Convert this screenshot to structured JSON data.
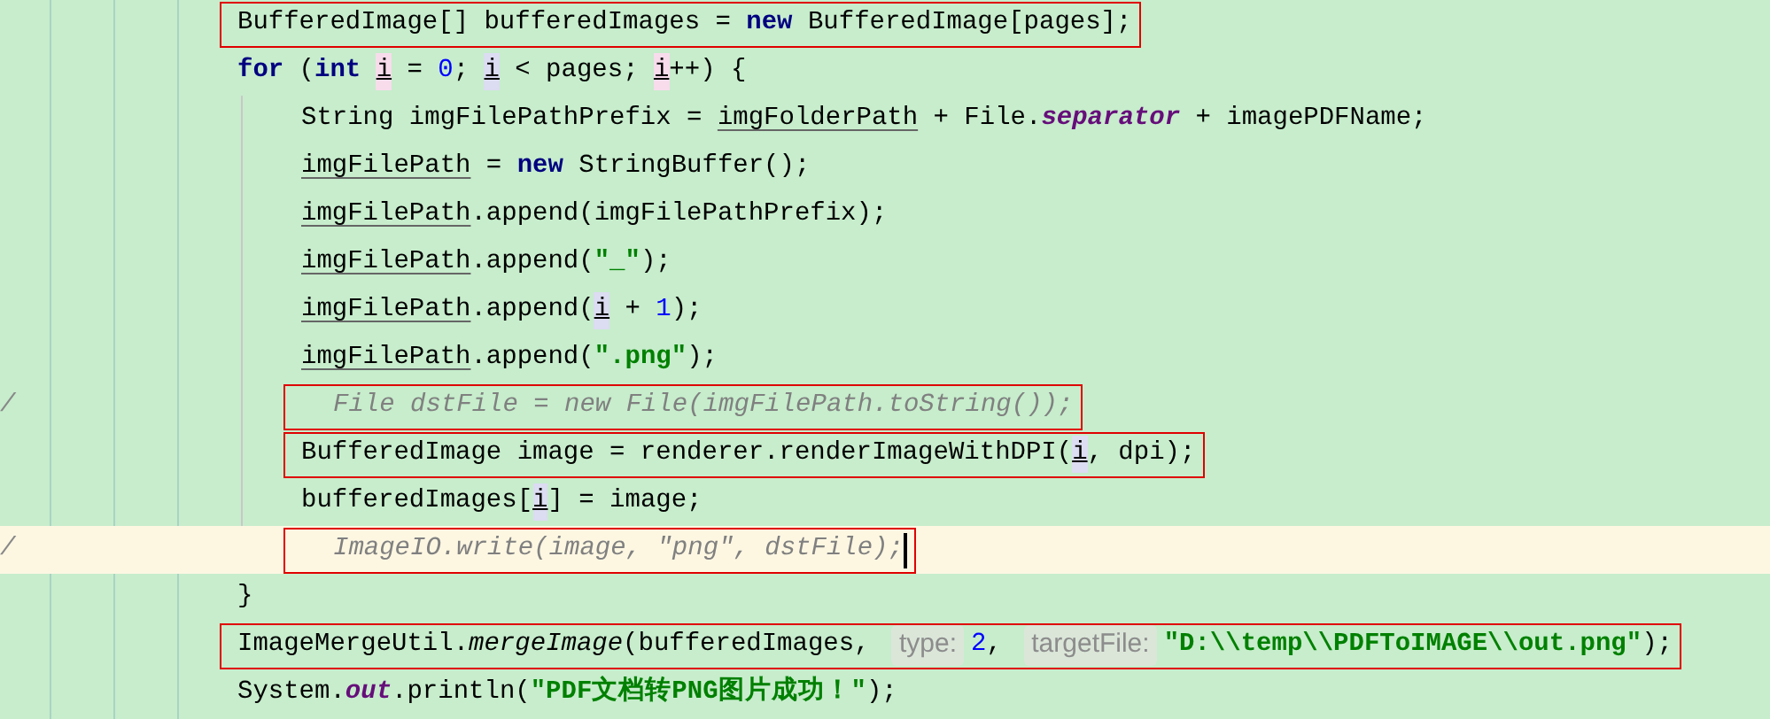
{
  "lines": [
    {
      "tokens": [
        {
          "kind": "plain",
          "text": "BufferedImage[] bufferedImages = "
        },
        {
          "kind": "kw",
          "text": "new"
        },
        {
          "kind": "plain",
          "text": " BufferedImage[pages];"
        }
      ],
      "boxed": true,
      "current": false
    },
    {
      "tokens": [
        {
          "kind": "kw",
          "text": "for"
        },
        {
          "kind": "plain",
          "text": " ("
        },
        {
          "kind": "kw",
          "text": "int "
        },
        {
          "kind": "iw",
          "text": "i"
        },
        {
          "kind": "plain",
          "text": " = "
        },
        {
          "kind": "num",
          "text": "0"
        },
        {
          "kind": "plain",
          "text": "; "
        },
        {
          "kind": "ir",
          "text": "i"
        },
        {
          "kind": "plain",
          "text": " < pages; "
        },
        {
          "kind": "iw",
          "text": "i"
        },
        {
          "kind": "plain",
          "text": "++) {"
        }
      ],
      "boxed": false,
      "current": false,
      "children": [
        {
          "tokens": [
            {
              "kind": "plain",
              "text": "String imgFilePathPrefix = "
            },
            {
              "kind": "ul",
              "text": "imgFolderPath"
            },
            {
              "kind": "plain",
              "text": " + File."
            },
            {
              "kind": "field",
              "text": "separator"
            },
            {
              "kind": "plain",
              "text": " + imagePDFName;"
            }
          ],
          "boxed": false,
          "current": false
        },
        {
          "tokens": [
            {
              "kind": "ul",
              "text": "imgFilePath"
            },
            {
              "kind": "plain",
              "text": " = "
            },
            {
              "kind": "kw",
              "text": "new"
            },
            {
              "kind": "plain",
              "text": " StringBuffer();"
            }
          ],
          "boxed": false,
          "current": false
        },
        {
          "tokens": [
            {
              "kind": "ul",
              "text": "imgFilePath"
            },
            {
              "kind": "plain",
              "text": ".append(imgFilePathPrefix);"
            }
          ],
          "boxed": false,
          "current": false
        },
        {
          "tokens": [
            {
              "kind": "ul",
              "text": "imgFilePath"
            },
            {
              "kind": "plain",
              "text": ".append("
            },
            {
              "kind": "str",
              "text": "\"_\""
            },
            {
              "kind": "plain",
              "text": ");"
            }
          ],
          "boxed": false,
          "current": false
        },
        {
          "tokens": [
            {
              "kind": "ul",
              "text": "imgFilePath"
            },
            {
              "kind": "plain",
              "text": ".append("
            },
            {
              "kind": "ir",
              "text": "i"
            },
            {
              "kind": "plain",
              "text": " + "
            },
            {
              "kind": "num",
              "text": "1"
            },
            {
              "kind": "plain",
              "text": ");"
            }
          ],
          "boxed": false,
          "current": false
        },
        {
          "tokens": [
            {
              "kind": "ul",
              "text": "imgFilePath"
            },
            {
              "kind": "plain",
              "text": ".append("
            },
            {
              "kind": "str",
              "text": "\".png\""
            },
            {
              "kind": "plain",
              "text": ");"
            }
          ],
          "boxed": false,
          "current": false
        },
        {
          "gutter": "/",
          "tokens": [
            {
              "kind": "comment",
              "text": "File dstFile = new File(imgFilePath.toString());"
            }
          ],
          "boxed": true,
          "current": false
        },
        {
          "tokens": [
            {
              "kind": "plain",
              "text": "BufferedImage image = renderer.renderImageWithDPI("
            },
            {
              "kind": "ir",
              "text": "i"
            },
            {
              "kind": "plain",
              "text": ", dpi);"
            }
          ],
          "boxed": true,
          "current": false
        },
        {
          "tokens": [
            {
              "kind": "plain",
              "text": "bufferedImages["
            },
            {
              "kind": "ir",
              "text": "i"
            },
            {
              "kind": "plain",
              "text": "] = image;"
            }
          ],
          "boxed": false,
          "current": false
        },
        {
          "gutter": "/",
          "tokens": [
            {
              "kind": "comment",
              "text": "ImageIO.write(image, \"png\", dstFile);"
            }
          ],
          "boxed": true,
          "current": true
        }
      ]
    },
    {
      "tokens": [
        {
          "kind": "plain",
          "text": "}"
        }
      ],
      "boxed": false,
      "current": false
    },
    {
      "tokens": [
        {
          "kind": "plain",
          "text": "ImageMergeUtil."
        },
        {
          "kind": "static",
          "text": "mergeImage"
        },
        {
          "kind": "plain",
          "text": "(bufferedImages, "
        },
        {
          "kind": "hint",
          "text": "type:"
        },
        {
          "kind": "num",
          "text": "2"
        },
        {
          "kind": "plain",
          "text": ", "
        },
        {
          "kind": "hint",
          "text": "targetFile:"
        },
        {
          "kind": "str",
          "text": "\"D:\\\\temp\\\\PDFToIMAGE\\\\out.png\""
        },
        {
          "kind": "plain",
          "text": ");"
        }
      ],
      "boxed": true,
      "current": false
    },
    {
      "tokens": [
        {
          "kind": "plain",
          "text": "System."
        },
        {
          "kind": "field",
          "text": "out"
        },
        {
          "kind": "plain",
          "text": ".println("
        },
        {
          "kind": "str",
          "text": "\"PDF文档转PNG图片成功！\""
        },
        {
          "kind": "plain",
          "text": ");"
        }
      ],
      "boxed": false,
      "current": false
    }
  ]
}
